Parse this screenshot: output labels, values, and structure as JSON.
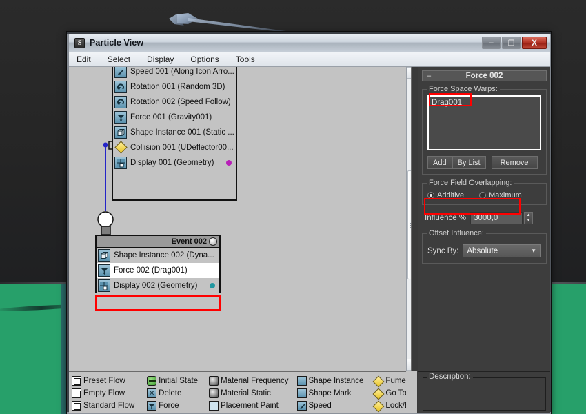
{
  "window": {
    "title": "Particle View",
    "app_icon": "particle-view-icon",
    "buttons": {
      "minimize": "–",
      "maximize": "❐",
      "close": "X"
    }
  },
  "menubar": {
    "items": [
      {
        "label": "Edit"
      },
      {
        "label": "Select"
      },
      {
        "label": "Display"
      },
      {
        "label": "Options"
      },
      {
        "label": "Tools"
      }
    ]
  },
  "canvas": {
    "event_001": {
      "nodes": [
        {
          "label": "Speed 001 (Along Icon Arro...",
          "icon": "speed-icon",
          "dot": "none"
        },
        {
          "label": "Rotation 001 (Random 3D)",
          "icon": "rotation-icon",
          "dot": "none"
        },
        {
          "label": "Rotation 002 (Speed Follow)",
          "icon": "rotation-icon",
          "dot": "none"
        },
        {
          "label": "Force 001 (Gravity001)",
          "icon": "force-icon",
          "dot": "none"
        },
        {
          "label": "Shape Instance 001 (Static ...",
          "icon": "shape-instance-icon",
          "dot": "none"
        },
        {
          "label": "Collision 001 (UDeflector00...",
          "icon": "collision-diamond-icon",
          "dot": "none"
        },
        {
          "label": "Display 001 (Geometry)",
          "icon": "display-icon",
          "dot": "magenta"
        }
      ]
    },
    "event_002": {
      "title": "Event 002",
      "lamp": "light-bulb-icon",
      "nodes": [
        {
          "label": "Shape Instance 002 (Dyna...",
          "icon": "shape-instance-icon",
          "dot": "none",
          "selected": false
        },
        {
          "label": "Force 002 (Drag001)",
          "icon": "force-icon",
          "dot": "none",
          "selected": true
        },
        {
          "label": "Display 002 (Geometry)",
          "icon": "display-icon",
          "dot": "teal",
          "selected": false
        }
      ]
    }
  },
  "params": {
    "rollup_title": "Force 002",
    "collapse_glyph": "–",
    "force_space_warps": {
      "group_title": "Force Space Warps:",
      "items": [
        "Drag001"
      ],
      "add_label": "Add",
      "by_list_label": "By List",
      "remove_label": "Remove"
    },
    "force_field_overlapping": {
      "group_title": "Force Field Overlapping:",
      "options": [
        "Additive",
        "Maximum"
      ],
      "selected": "Additive"
    },
    "influence": {
      "label": "Influence %",
      "value": "3000,0"
    },
    "offset_influence": {
      "group_title": "Offset Influence:",
      "sync_label": "Sync By:",
      "sync_value": "Absolute",
      "sync_arrow": "▼"
    }
  },
  "depot": {
    "columns": [
      [
        {
          "label": "Preset Flow",
          "icon": "flow-icon"
        },
        {
          "label": "Empty Flow",
          "icon": "flow-icon"
        },
        {
          "label": "Standard Flow",
          "icon": "flow-icon"
        }
      ],
      [
        {
          "label": "Initial State",
          "icon": "initial-state-icon"
        },
        {
          "label": "Delete",
          "icon": "delete-icon"
        },
        {
          "label": "Force",
          "icon": "force-icon"
        }
      ],
      [
        {
          "label": "Material Frequency",
          "icon": "material-icon"
        },
        {
          "label": "Material Static",
          "icon": "material-icon"
        },
        {
          "label": "Placement Paint",
          "icon": "placement-paint-icon"
        }
      ],
      [
        {
          "label": "Shape Instance",
          "icon": "shape-instance-icon"
        },
        {
          "label": "Shape Mark",
          "icon": "shape-mark-icon"
        },
        {
          "label": "Speed",
          "icon": "speed-icon"
        }
      ],
      [
        {
          "label": "FumeFX",
          "icon": "fumefx-icon"
        },
        {
          "label": "Go To R",
          "icon": "goto-rotation-icon"
        },
        {
          "label": "Lock/Bo",
          "icon": "lock-bond-icon"
        }
      ]
    ]
  },
  "description": {
    "title": "Description:",
    "text": ""
  },
  "colors": {
    "highlight": "#ff0000",
    "accent_blue": "#5b92ae",
    "ground_green": "#27a06a",
    "panel_gray": "#3d3d3d"
  }
}
